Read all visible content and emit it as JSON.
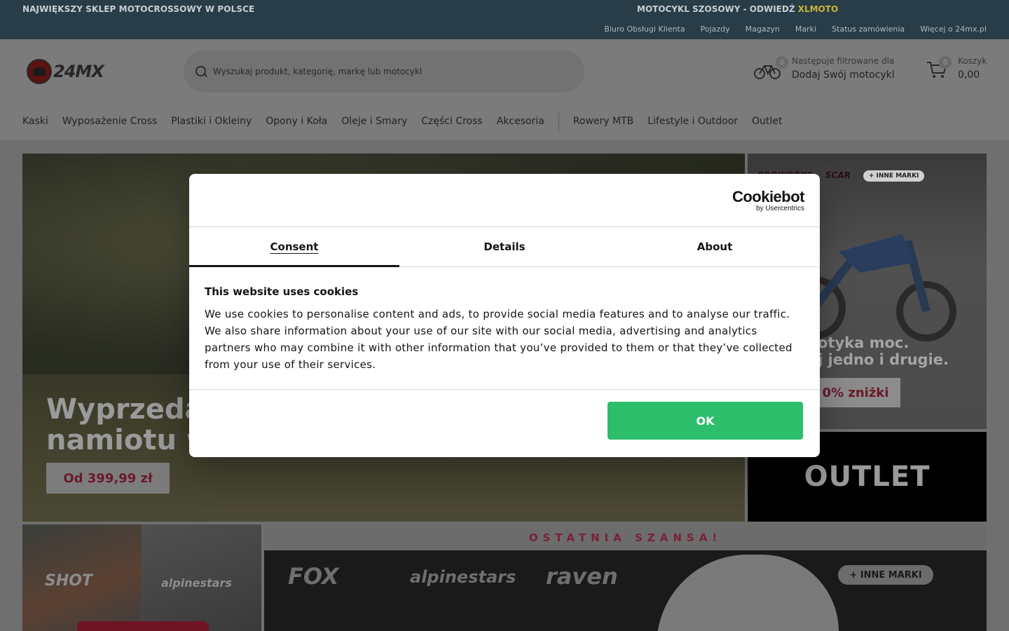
{
  "topbar": {
    "left_promo": "NAJWIĘKSZY SKLEP MOTOCROSSOWY W POLSCE",
    "mid_promo_prefix": "MOTOCYKL SZOSOWY - ODWIEDŹ",
    "mid_promo_highlight": "XLMOTO",
    "links": [
      "Biuro Obsługi Klienta",
      "Pojazdy",
      "Magazyn",
      "Marki",
      "Status zamówienia",
      "Więcej o 24mx.pl"
    ]
  },
  "header": {
    "logo_text": "24MX",
    "search_placeholder": "Wyszukaj produkt, kategorię, markę lub motocykl",
    "bike": {
      "badge": "0",
      "small": "Następuje filtrowane dla",
      "big": "Dodaj Swój motocykl"
    },
    "cart": {
      "badge": "0",
      "small": "Koszyk",
      "big": "0,00"
    }
  },
  "nav": {
    "items_left": [
      "Kaski",
      "Wyposażenie Cross",
      "Plastiki i Okleiny",
      "Opony i Koła",
      "Oleje i Smary",
      "Części Cross",
      "Akcesoria"
    ],
    "items_right": [
      "Rowery MTB",
      "Lifestyle i Outdoor",
      "Outlet"
    ]
  },
  "hero": {
    "headline_line1": "Wyprzeda",
    "headline_line2": "namiotu w",
    "price_button": "Od 399,99 zł"
  },
  "side_promo": {
    "brands": [
      "PROWORKS",
      "SCAR"
    ],
    "more_brands": "+ INNE MARKI",
    "line1": "otyka moc.",
    "line2": "j jedno i drugie.",
    "discount": "0% zniżki"
  },
  "outlet": {
    "label": "OUTLET"
  },
  "bottom_left": {
    "brand1": "SHOT",
    "brand2": "alpinestars"
  },
  "last_chance": {
    "label": "OSTATNIA SZANSA!"
  },
  "brands_banner": {
    "brands": [
      "FOX",
      "alpinestars",
      "raven"
    ],
    "more": "+ INNE MARKI"
  },
  "cookie_dialog": {
    "provider_name": "Cookiebot",
    "provider_by": "by Usercentrics",
    "tabs": [
      "Consent",
      "Details",
      "About"
    ],
    "active_tab": "Consent",
    "heading": "This website uses cookies",
    "body": "We use cookies to personalise content and ads, to provide social media features and to analyse our traffic. We also share information about your use of our site with our social media, advertising and analytics partners who may combine it with other information that you’ve provided to them or that they’ve collected from your use of their services.",
    "ok_label": "OK"
  },
  "colors": {
    "topbar_bg": "#283d47",
    "accent_yellow": "#c9b23a",
    "ok_green": "#2dbe6c",
    "brand_red": "#7c2035"
  }
}
